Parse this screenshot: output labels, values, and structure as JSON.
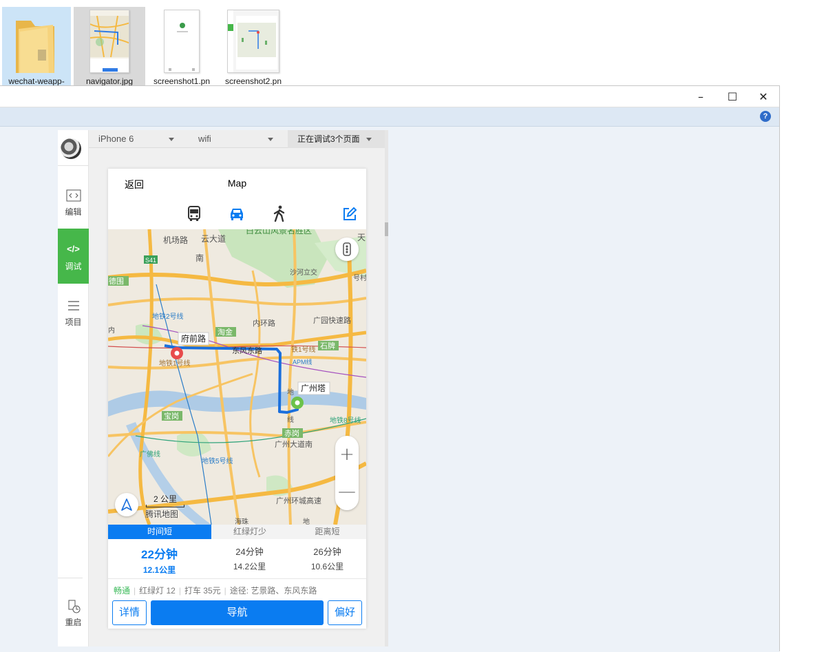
{
  "desktop": {
    "files": [
      {
        "name": "wechat-weapp-",
        "icon": "folder-icon"
      },
      {
        "name": "navigator.jpg",
        "icon": "image-file-icon"
      },
      {
        "name": "screenshot1.pn",
        "icon": "image-file-icon"
      },
      {
        "name": "screenshot2.pn",
        "icon": "image-file-icon"
      }
    ]
  },
  "window": {
    "controls": {
      "minimize": "–",
      "maximize": "☐",
      "close": "✕"
    },
    "help": "?"
  },
  "sidebar": {
    "items": [
      {
        "label": "编辑",
        "icon": "code-file-icon"
      },
      {
        "label": "调试",
        "icon": "code-icon"
      },
      {
        "label": "项目",
        "icon": "menu-icon"
      },
      {
        "label": "重启",
        "icon": "restart-icon"
      }
    ]
  },
  "device_bar": {
    "device": "iPhone 6",
    "network": "wifi",
    "debug": "正在调试3个页面"
  },
  "phone": {
    "nav": {
      "back": "返回",
      "title": "Map"
    },
    "modes": [
      "bus-icon",
      "car-icon",
      "walk-icon",
      "edit-icon"
    ],
    "accent": "#0a7cf1",
    "map": {
      "start_label": "府前路",
      "end_label": "广州塔",
      "labels": {
        "area1": "白云山风景名胜区",
        "r1": "机场路",
        "r2": "云大道",
        "r3": "南",
        "s41": "S41",
        "dehe": "德围",
        "shahe": "沙河立交",
        "yu": "天",
        "yu2": "号村",
        "guangyuan": "广园快速路",
        "huan": "内环路",
        "taojin": "淘金",
        "dongfeng": "东风东路",
        "shipai": "石牌",
        "metro1": "地铁1号线",
        "metro1b": "铁1号线",
        "apm": "APM线",
        "baogang": "宝岗",
        "chigang": "赤岗",
        "metro8": "地铁8号线",
        "guangzhou_ave": "广州大道南",
        "metro2": "地铁2号线",
        "line_guangfo": "广佛线",
        "huancheng": "广州环城高速",
        "metro5": "地铁5号线",
        "dao": "道",
        "nei": "内",
        "bottom1": "海珠",
        "di": "地",
        "xian": "线"
      },
      "scale": "2 公里",
      "brand": "腾讯地图"
    },
    "tabs": [
      "时间短",
      "红绿灯少",
      "距离短"
    ],
    "routes": [
      {
        "time": "22分钟",
        "distance": "12.1公里"
      },
      {
        "time": "24分钟",
        "distance": "14.2公里"
      },
      {
        "time": "26分钟",
        "distance": "10.6公里"
      }
    ],
    "summary": {
      "traffic": "畅通",
      "lights": "红绿灯 12",
      "taxi": "打车 35元",
      "via": "途径: 艺景路、东风东路"
    },
    "actions": {
      "detail": "详情",
      "navigate": "导航",
      "prefs": "偏好"
    }
  }
}
